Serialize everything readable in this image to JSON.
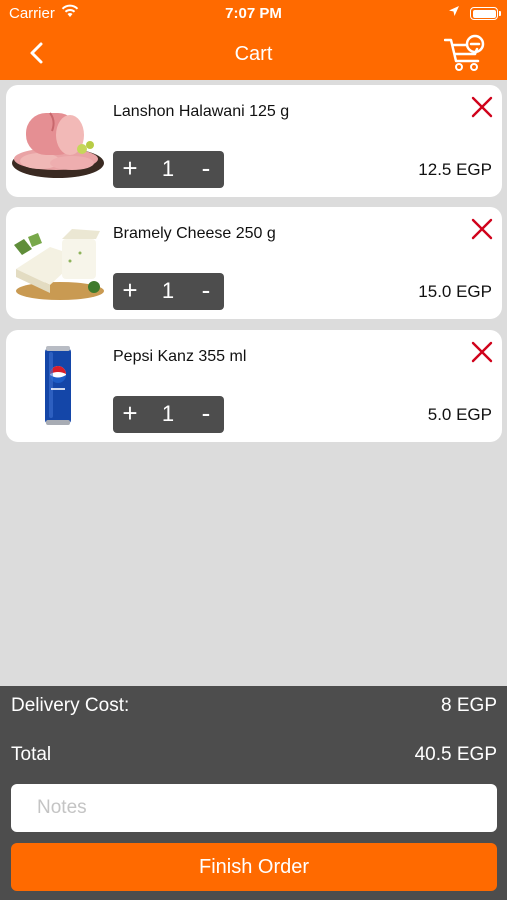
{
  "status_bar": {
    "carrier": "Carrier",
    "time": "7:07 PM"
  },
  "header": {
    "title": "Cart",
    "back_icon": "chevron-left-icon",
    "cart_icon": "cart-remove-icon"
  },
  "cart": {
    "items": [
      {
        "name": "Lanshon Halawani 125 g",
        "quantity": "1",
        "price": "12.5 EGP",
        "image": "luncheon-meat"
      },
      {
        "name": "Bramely Cheese 250 g",
        "quantity": "1",
        "price": "15.0 EGP",
        "image": "cheese"
      },
      {
        "name": "Pepsi Kanz 355 ml",
        "quantity": "1",
        "price": "5.0 EGP",
        "image": "pepsi-can"
      }
    ],
    "stepper_plus": "+",
    "stepper_minus": "-"
  },
  "summary": {
    "delivery_label": "Delivery Cost:",
    "delivery_value": "8 EGP",
    "total_label": "Total",
    "total_value": "40.5 EGP"
  },
  "notes": {
    "placeholder": "Notes",
    "value": ""
  },
  "finish_button": "Finish Order",
  "colors": {
    "accent": "#ff6a00",
    "dark": "#4d4d4d",
    "background": "#dcdcdc",
    "remove": "#d0021b"
  }
}
